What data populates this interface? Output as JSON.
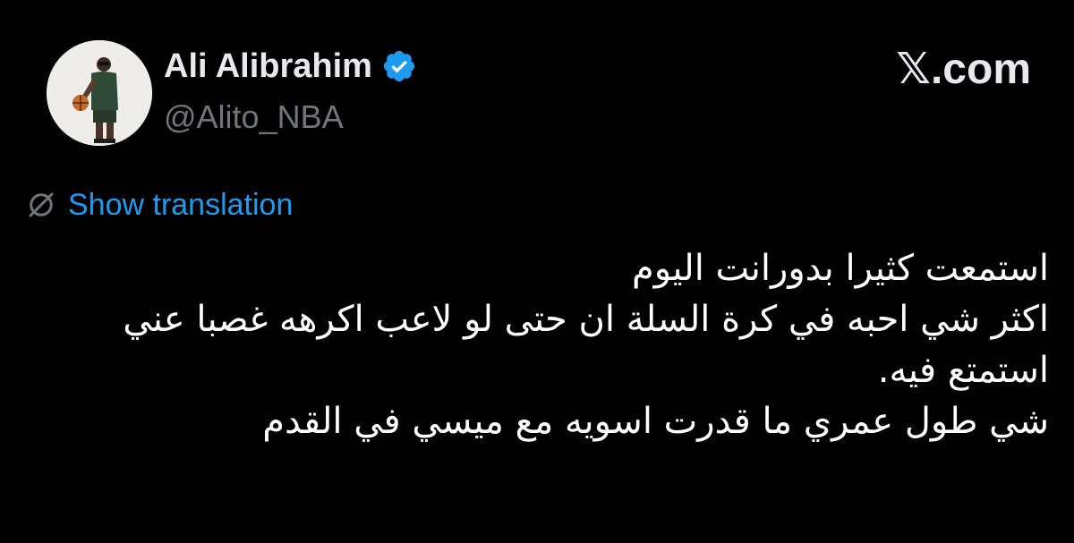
{
  "tweet": {
    "author": {
      "display_name": "Ali Alibrahim",
      "handle": "@Alito_NBA",
      "verified": true,
      "avatar_icon": "profile-photo"
    },
    "brand": "𝕏.com",
    "show_translation": "Show translation",
    "lines": [
      "استمعت كثيرا بدورانت اليوم",
      "اكثر شي احبه في كرة السلة ان حتى لو لاعب اكرهه غصبا عني",
      "استمتع فيه.",
      "شي طول عمري ما قدرت اسويه مع ميسي في القدم"
    ]
  },
  "colors": {
    "background": "#000000",
    "text_primary": "#e7e9ea",
    "text_secondary": "#71767b",
    "link": "#1d9bf0",
    "verified_badge": "#1d9bf0"
  },
  "icons": {
    "verified": "verified-badge-icon",
    "translate": "globe-slash-icon"
  }
}
